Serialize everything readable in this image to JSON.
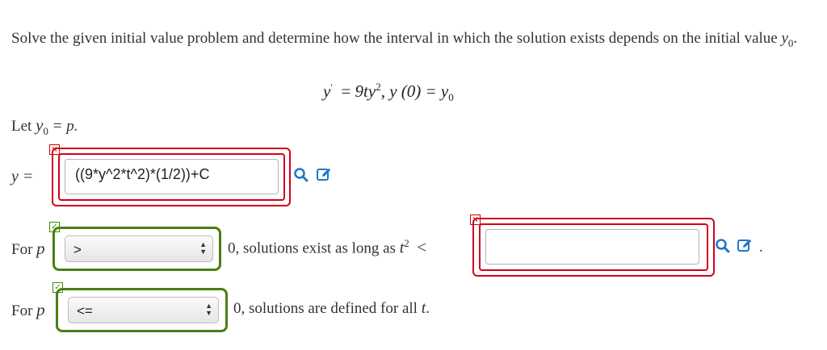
{
  "problem": {
    "instructions_text": "Solve the given initial value problem and determine how the interval in which the solution exists depends on the initial value",
    "instructions_var": "y",
    "instructions_sub": "0",
    "equation": {
      "lhs": "y",
      "prime": "′",
      "rhs_ty": "9ty",
      "rhs_exp": "2",
      "ic": "y (0) = y",
      "ic_sub": "0"
    },
    "let_prefix": "Let",
    "let_var": "y",
    "let_sub": "0",
    "let_rest": "= p."
  },
  "answer_row": {
    "label": "y =",
    "value": "((9*y^2*t^2)*(1/2))+C",
    "status": "incorrect"
  },
  "row_positive": {
    "label_for": "For",
    "label_p": "p",
    "select_value": ">",
    "status_select": "correct",
    "text_after": "0, solutions exist as long as",
    "t_var": "t",
    "t_exp": "2",
    "lt": "<",
    "input_value": "",
    "status_input": "incorrect",
    "trailing": "."
  },
  "row_negative": {
    "label_for": "For",
    "label_p": "p",
    "select_value": "<=",
    "status_select": "correct",
    "text_after": "0, solutions are defined for all",
    "t_var": "t",
    "trailing": "."
  },
  "icons": {
    "preview": "magnifier-icon",
    "edit": "pencil-edit-icon",
    "incorrect_mark": "×",
    "correct_mark": "✓"
  },
  "colors": {
    "incorrect": "#d0021b",
    "correct": "#4a7f12",
    "icon_blue": "#1f78c8"
  }
}
